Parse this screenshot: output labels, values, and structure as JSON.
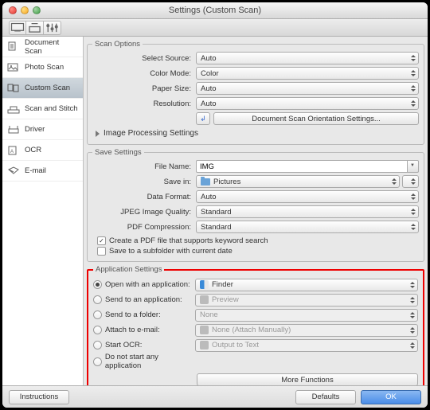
{
  "window": {
    "title": "Settings (Custom Scan)"
  },
  "sidebar": {
    "items": [
      {
        "label": "Document Scan"
      },
      {
        "label": "Photo Scan"
      },
      {
        "label": "Custom Scan"
      },
      {
        "label": "Scan and Stitch"
      },
      {
        "label": "Driver"
      },
      {
        "label": "OCR"
      },
      {
        "label": "E-mail"
      }
    ],
    "selected_index": 2
  },
  "scan_options": {
    "legend": "Scan Options",
    "select_source": {
      "label": "Select Source:",
      "value": "Auto"
    },
    "color_mode": {
      "label": "Color Mode:",
      "value": "Color"
    },
    "paper_size": {
      "label": "Paper Size:",
      "value": "Auto"
    },
    "resolution": {
      "label": "Resolution:",
      "value": "Auto"
    },
    "orientation_btn": "Document Scan Orientation Settings...",
    "image_processing": "Image Processing Settings"
  },
  "save_settings": {
    "legend": "Save Settings",
    "file_name": {
      "label": "File Name:",
      "value": "IMG"
    },
    "save_in": {
      "label": "Save in:",
      "value": "Pictures"
    },
    "data_format": {
      "label": "Data Format:",
      "value": "Auto"
    },
    "jpeg_quality": {
      "label": "JPEG Image Quality:",
      "value": "Standard"
    },
    "pdf_compression": {
      "label": "PDF Compression:",
      "value": "Standard"
    },
    "create_pdf": {
      "label": "Create a PDF file that supports keyword search",
      "checked": true
    },
    "save_subfolder": {
      "label": "Save to a subfolder with current date",
      "checked": false
    }
  },
  "app_settings": {
    "legend": "Application Settings",
    "selected": "open_with",
    "open_with": {
      "label": "Open with an application:",
      "value": "Finder"
    },
    "send_app": {
      "label": "Send to an application:",
      "value": "Preview"
    },
    "send_folder": {
      "label": "Send to a folder:",
      "value": "None"
    },
    "attach_email": {
      "label": "Attach to e-mail:",
      "value": "None (Attach Manually)"
    },
    "start_ocr": {
      "label": "Start OCR:",
      "value": "Output to Text"
    },
    "no_start": {
      "label": "Do not start any application"
    },
    "more_functions": "More Functions"
  },
  "footer": {
    "instructions": "Instructions",
    "defaults": "Defaults",
    "ok": "OK"
  }
}
